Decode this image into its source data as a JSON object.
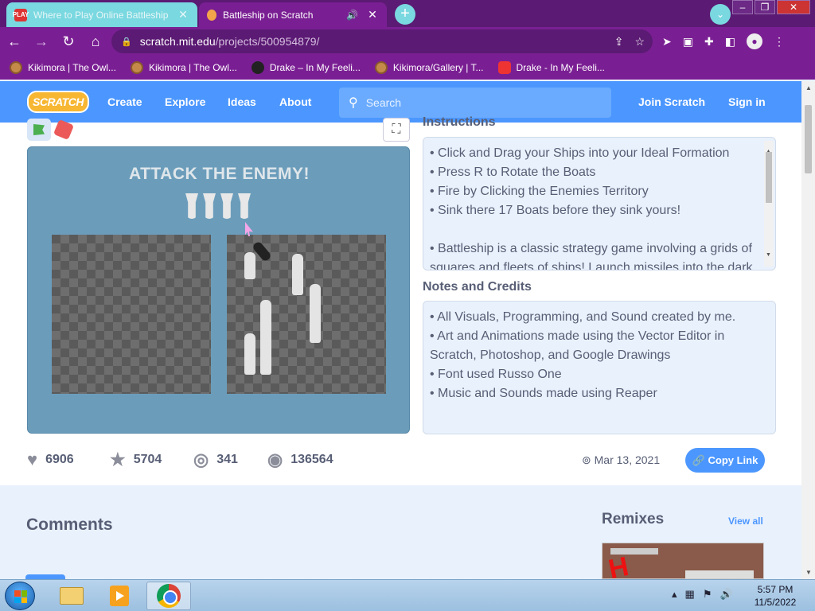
{
  "browser": {
    "tabs": [
      {
        "title": "Where to Play Online Battleship",
        "favicon_text": "PLAY",
        "active": false
      },
      {
        "title": "Battleship on Scratch",
        "active": true
      }
    ],
    "new_tab_label": "+",
    "address": {
      "host": "scratch.mit.edu",
      "path": "/projects/500954879/"
    },
    "bookmarks": [
      {
        "label": "Kikimora | The Owl...",
        "icon": "owl-icon"
      },
      {
        "label": "Kikimora | The Owl...",
        "icon": "owl-icon"
      },
      {
        "label": "Drake – In My Feeli...",
        "icon": "drake-icon"
      },
      {
        "label": "Kikimora/Gallery | T...",
        "icon": "owl-icon"
      },
      {
        "label": "Drake - In My Feeli...",
        "icon": "youtube-icon"
      }
    ]
  },
  "scratch_nav": {
    "logo": "SCRATCH",
    "links": [
      "Create",
      "Explore",
      "Ideas",
      "About"
    ],
    "search_placeholder": "Search",
    "join": "Join Scratch",
    "signin": "Sign in"
  },
  "stage": {
    "title": "ATTACK THE ENEMY!",
    "missiles_remaining": 4
  },
  "instructions": {
    "label": "Instructions",
    "lines": [
      "• Click and Drag your Ships into your Ideal Formation",
      "• Press R to Rotate the Boats",
      "• Fire by Clicking the Enemies Territory",
      "• Sink there 17 Boats before they sink yours!",
      "",
      "• Battleship is a classic strategy game involving a grids of",
      "squares and fleets of ships! Launch missiles into the dark"
    ]
  },
  "notes": {
    "label": "Notes and Credits",
    "lines": [
      "• All Visuals, Programming, and Sound created by me.",
      "• Art and Animations made using the Vector Editor in",
      "Scratch, Photoshop, and Google Drawings",
      "• Font used Russo One",
      "• Music and Sounds made using Reaper"
    ]
  },
  "stats": {
    "loves": "6906",
    "favorites": "5704",
    "remixes": "341",
    "views": "136564"
  },
  "date": "Mar 13, 2021",
  "copy_link": "Copy Link",
  "comments_title": "Comments",
  "remixes_title": "Remixes",
  "view_all": "View all",
  "taskbar": {
    "time": "5:57 PM",
    "date": "11/5/2022"
  },
  "colors": {
    "scratch_blue": "#4c97ff",
    "chrome_purple": "#7a1f93",
    "stage_bg": "#6b9dbb"
  }
}
